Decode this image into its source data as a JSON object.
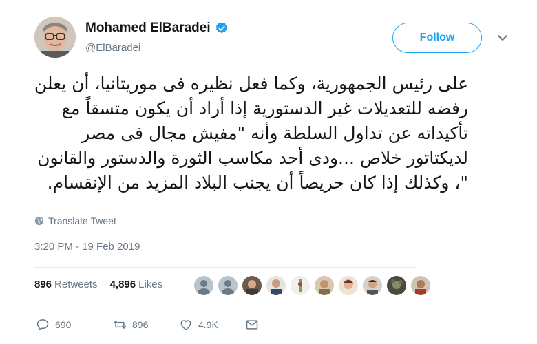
{
  "user": {
    "display_name": "Mohamed ElBaradei",
    "handle": "@ElBaradei",
    "follow_label": "Follow"
  },
  "tweet": {
    "lines": [
      "على رئيس الجمهورية، وكما فعل نظيره فى موريتانيا، أن يعلن",
      "رفضه للتعديلات غير الدستورية  إذا أراد أن يكون متسقاً مع",
      "تأكيداته عن تداول السلطة وأنه \"مفيش مجال فى مصر",
      "لديكتاتور خلاص ...ودى أحد مكاسب الثورة والدستور والقانون",
      "\"، وكذلك إذا كان حريصاً أن يجنب البلاد المزيد من الإنقسام."
    ],
    "translate_label": "Translate Tweet",
    "timestamp": "3:20 PM - 19 Feb 2019"
  },
  "stats": {
    "retweets_count": "896",
    "retweets_label": "Retweets",
    "likes_count": "4,896",
    "likes_label": "Likes"
  },
  "actions": {
    "replies": "690",
    "retweets": "896",
    "likes": "4.9K"
  },
  "colors": {
    "accent": "#1da1f2",
    "muted": "#657786",
    "divider": "#e6ecf0"
  }
}
